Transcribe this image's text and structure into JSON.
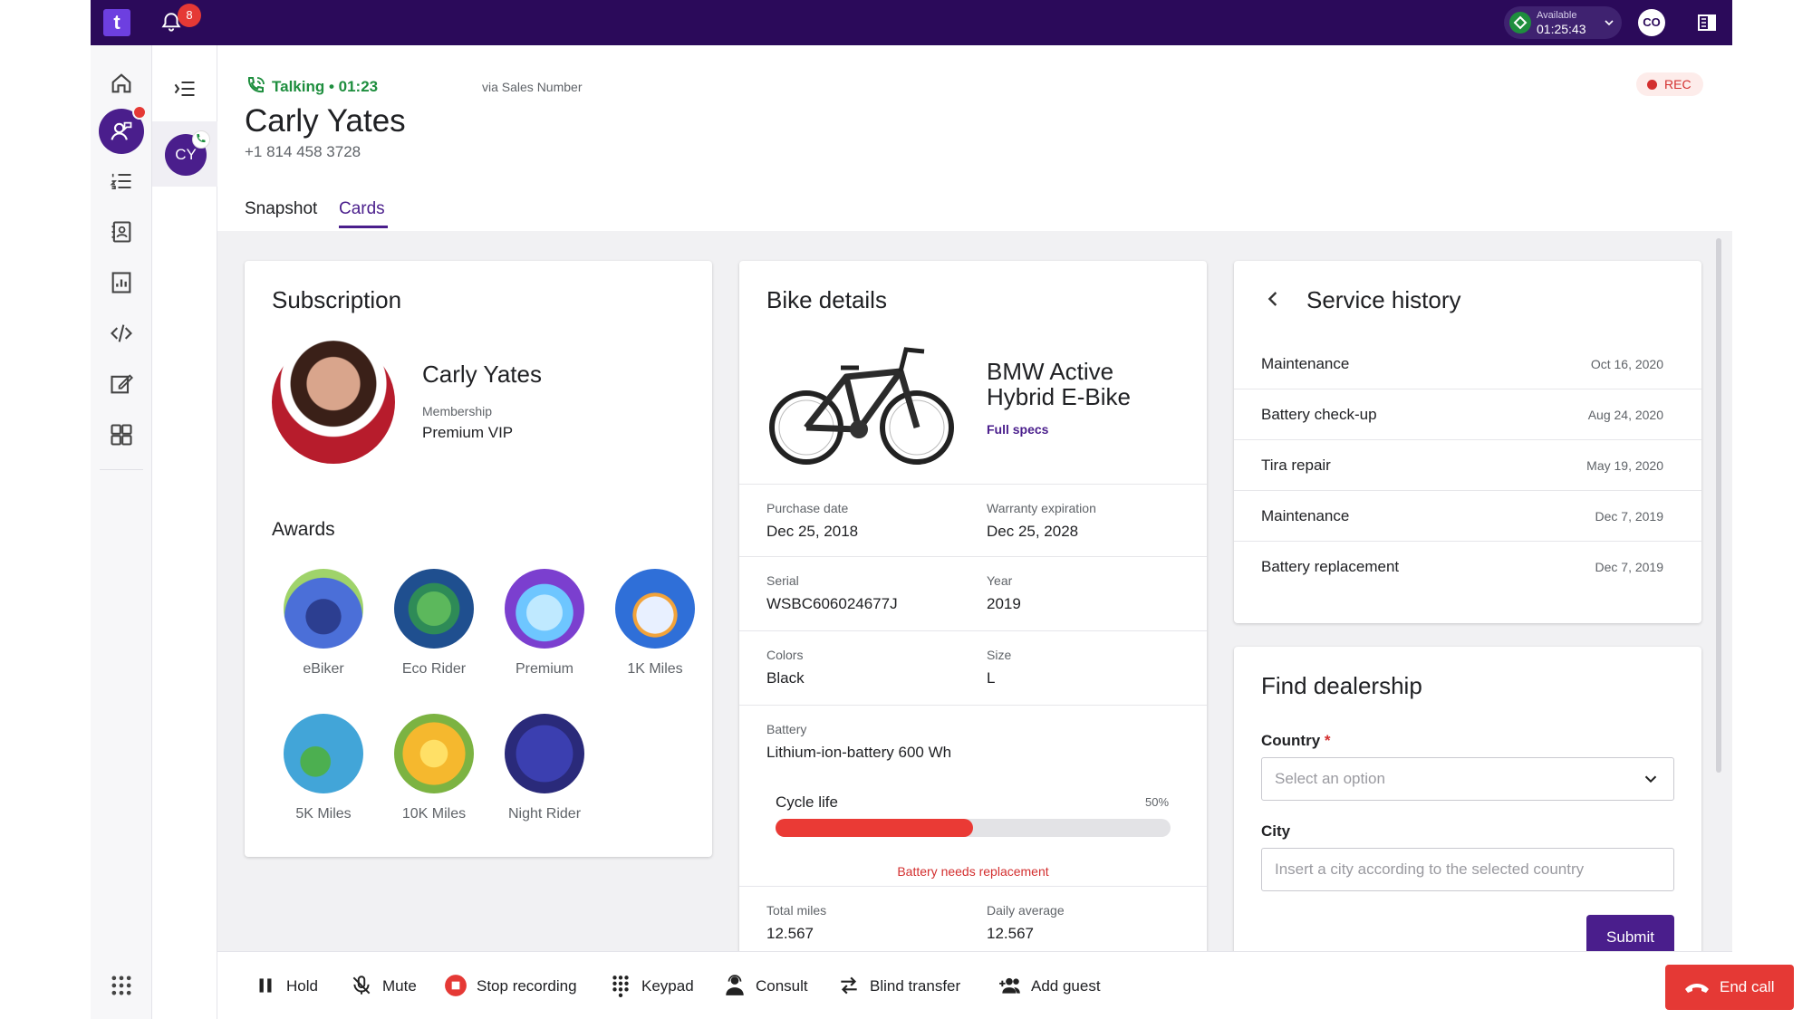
{
  "topbar": {
    "logo_text": "t",
    "notifications_count": "8",
    "status_label": "Available",
    "status_time": "01:25:43",
    "user_initials": "CO"
  },
  "conversation": {
    "avatar_initials": "CY"
  },
  "header": {
    "talk_status": "Talking • 01:23",
    "via": "via Sales Number",
    "contact_name": "Carly Yates",
    "contact_phone": "+1 814 458 3728",
    "rec_label": "REC",
    "tabs": [
      {
        "label": "Snapshot",
        "active": false
      },
      {
        "label": "Cards",
        "active": true
      }
    ]
  },
  "subscription": {
    "title": "Subscription",
    "name": "Carly Yates",
    "membership_label": "Membership",
    "membership_value": "Premium VIP",
    "awards_title": "Awards",
    "awards": [
      {
        "label": "eBiker",
        "icon": "ebike-award-icon",
        "color": "#4b6fd8"
      },
      {
        "label": "Eco Rider",
        "icon": "eco-rider-award-icon",
        "color": "#1f4f8f"
      },
      {
        "label": "Premium",
        "icon": "diamond-award-icon",
        "color": "#7b3fcf"
      },
      {
        "label": "1K Miles",
        "icon": "compass-award-icon",
        "color": "#2f6fd8"
      },
      {
        "label": "5K Miles",
        "icon": "globe-award-icon",
        "color": "#42a5d8"
      },
      {
        "label": "10K Miles",
        "icon": "star-medal-award-icon",
        "color": "#e8a623"
      },
      {
        "label": "Night Rider",
        "icon": "constellation-award-icon",
        "color": "#2a2a7a"
      }
    ]
  },
  "bike": {
    "title": "Bike details",
    "name": "BMW Active Hybrid E-Bike",
    "full_specs": "Full specs",
    "purchase_date_label": "Purchase date",
    "purchase_date": "Dec 25, 2018",
    "warranty_label": "Warranty expiration",
    "warranty": "Dec 25, 2028",
    "serial_label": "Serial",
    "serial": "WSBC606024677J",
    "year_label": "Year",
    "year": "2019",
    "colors_label": "Colors",
    "colors": "Black",
    "size_label": "Size",
    "size": "L",
    "battery_label": "Battery",
    "battery": "Lithium-ion-battery 600 Wh",
    "cycle_label": "Cycle life",
    "cycle_pct_text": "50%",
    "cycle_fraction": 0.5,
    "cycle_color": "#ea3a35",
    "battery_warning": "Battery needs replacement",
    "total_miles_label": "Total miles",
    "total_miles": "12.567",
    "daily_avg_label": "Daily average",
    "daily_avg": "12.567"
  },
  "service_history": {
    "title": "Service history",
    "items": [
      {
        "name": "Maintenance",
        "date": "Oct 16, 2020"
      },
      {
        "name": "Battery check-up",
        "date": "Aug 24, 2020"
      },
      {
        "name": "Tira repair",
        "date": "May 19, 2020"
      },
      {
        "name": "Maintenance",
        "date": "Dec 7, 2019"
      },
      {
        "name": "Battery replacement",
        "date": "Dec 7, 2019"
      }
    ]
  },
  "dealership": {
    "title": "Find dealership",
    "country_label": "Country",
    "required_mark": "*",
    "country_placeholder": "Select an option",
    "city_label": "City",
    "city_placeholder": "Insert a city according to the selected country",
    "submit_label": "Submit"
  },
  "toolbar": {
    "hold": "Hold",
    "mute": "Mute",
    "stop_recording": "Stop recording",
    "keypad": "Keypad",
    "consult": "Consult",
    "blind_transfer": "Blind transfer",
    "add_guest": "Add guest",
    "end_call": "End call"
  },
  "colors": {
    "brand": "#2b0a5a",
    "accent": "#4a1e8c",
    "talking": "#1e8e3e",
    "danger": "#e53935"
  }
}
